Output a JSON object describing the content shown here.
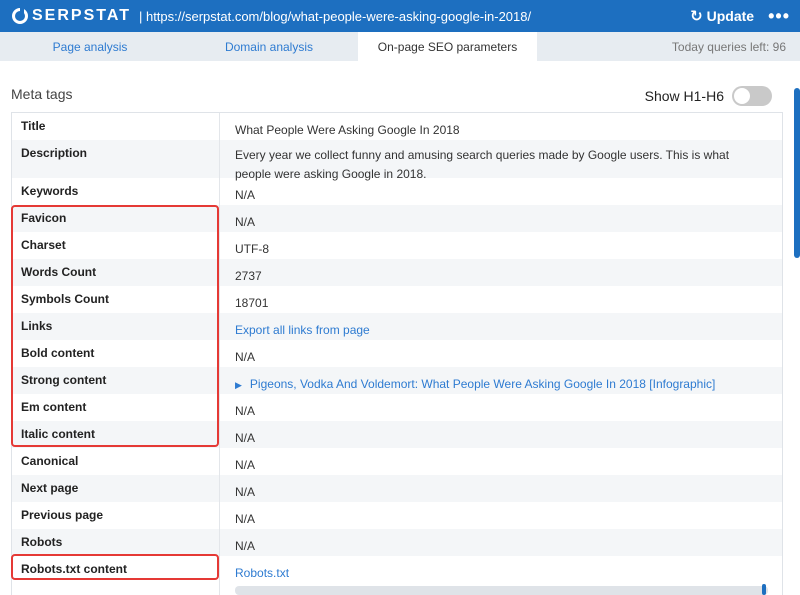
{
  "header": {
    "logo_text": "SERPSTAT",
    "url": "| https://serpstat.com/blog/what-people-were-asking-google-in-2018/",
    "update_label": "Update",
    "refresh_icon": "↻",
    "more_icon": "•••"
  },
  "tabs": [
    {
      "label": "Page analysis"
    },
    {
      "label": "Domain analysis"
    },
    {
      "label": "On-page SEO parameters"
    }
  ],
  "queries_left": "Today queries left: 96",
  "section_title": "Meta tags",
  "show_headings_label": "Show H1-H6",
  "rows": [
    {
      "label": "Title",
      "value": "What People Were Asking Google In 2018"
    },
    {
      "label": "Description",
      "value": "Every year we collect funny and amusing search queries made by Google users. This is what people were asking Google in 2018."
    },
    {
      "label": "Keywords",
      "value": "N/A"
    },
    {
      "label": "Favicon",
      "value": "N/A"
    },
    {
      "label": "Charset",
      "value": "UTF-8"
    },
    {
      "label": "Words Count",
      "value": "2737"
    },
    {
      "label": "Symbols Count",
      "value": "18701"
    },
    {
      "label": "Links",
      "value": "Export all links from page"
    },
    {
      "label": "Bold content",
      "value": "N/A"
    },
    {
      "label": "Strong content",
      "value": "Pigeons, Vodka And Voldemort: What People Were Asking Google In 2018 [Infographic]"
    },
    {
      "label": "Em content",
      "value": "N/A"
    },
    {
      "label": "Italic content",
      "value": "N/A"
    },
    {
      "label": "Canonical",
      "value": "N/A"
    },
    {
      "label": "Next page",
      "value": "N/A"
    },
    {
      "label": "Previous page",
      "value": "N/A"
    },
    {
      "label": "Robots",
      "value": "N/A"
    },
    {
      "label": "Robots.txt content",
      "value": "Robots.txt"
    }
  ],
  "colors": {
    "brand": "#1d6fc0",
    "link": "#2e7bd1",
    "highlight": "#e53935"
  }
}
